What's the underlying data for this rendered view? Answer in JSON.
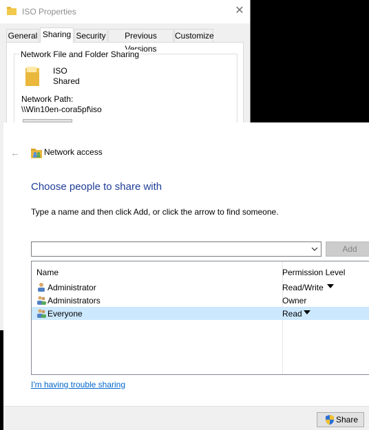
{
  "properties_window": {
    "title": "ISO Properties",
    "close_glyph": "✕",
    "tabs": [
      {
        "label": "General",
        "active": false
      },
      {
        "label": "Sharing",
        "active": true
      },
      {
        "label": "Security",
        "active": false
      },
      {
        "label": "Previous Versions",
        "active": false
      },
      {
        "label": "Customize",
        "active": false
      }
    ],
    "group_title": "Network File and Folder Sharing",
    "folder_name": "ISO",
    "folder_state": "Shared",
    "network_path_label": "Network Path:",
    "network_path_value": "\\\\Win10en-cora5pf\\iso",
    "icons": {
      "title": "folder-icon",
      "big": "folder-icon"
    }
  },
  "network_access": {
    "back_glyph": "←",
    "title": "Network access",
    "heading": "Choose people to share with",
    "instruction": "Type a name and then click Add, or click the arrow to find someone.",
    "name_input_value": "",
    "add_label": "Add",
    "columns": {
      "name": "Name",
      "permission": "Permission Level"
    },
    "rows": [
      {
        "name": "Administrator",
        "permission": "Read/Write",
        "has_dropdown": true,
        "selected": false,
        "icon": "user-icon"
      },
      {
        "name": "Administrators",
        "permission": "Owner",
        "has_dropdown": false,
        "selected": false,
        "icon": "users-group-icon"
      },
      {
        "name": "Everyone",
        "permission": "Read",
        "has_dropdown": true,
        "selected": true,
        "icon": "users-group-icon"
      }
    ],
    "trouble_link": "I'm having trouble sharing",
    "share_label": "Share",
    "share_icon": "uac-shield-icon"
  },
  "colors": {
    "heading": "#1e3c96",
    "link": "#0066cc",
    "selection": "#cce8ff",
    "disabled_button": "#cccccc",
    "desktop": "#000000"
  }
}
